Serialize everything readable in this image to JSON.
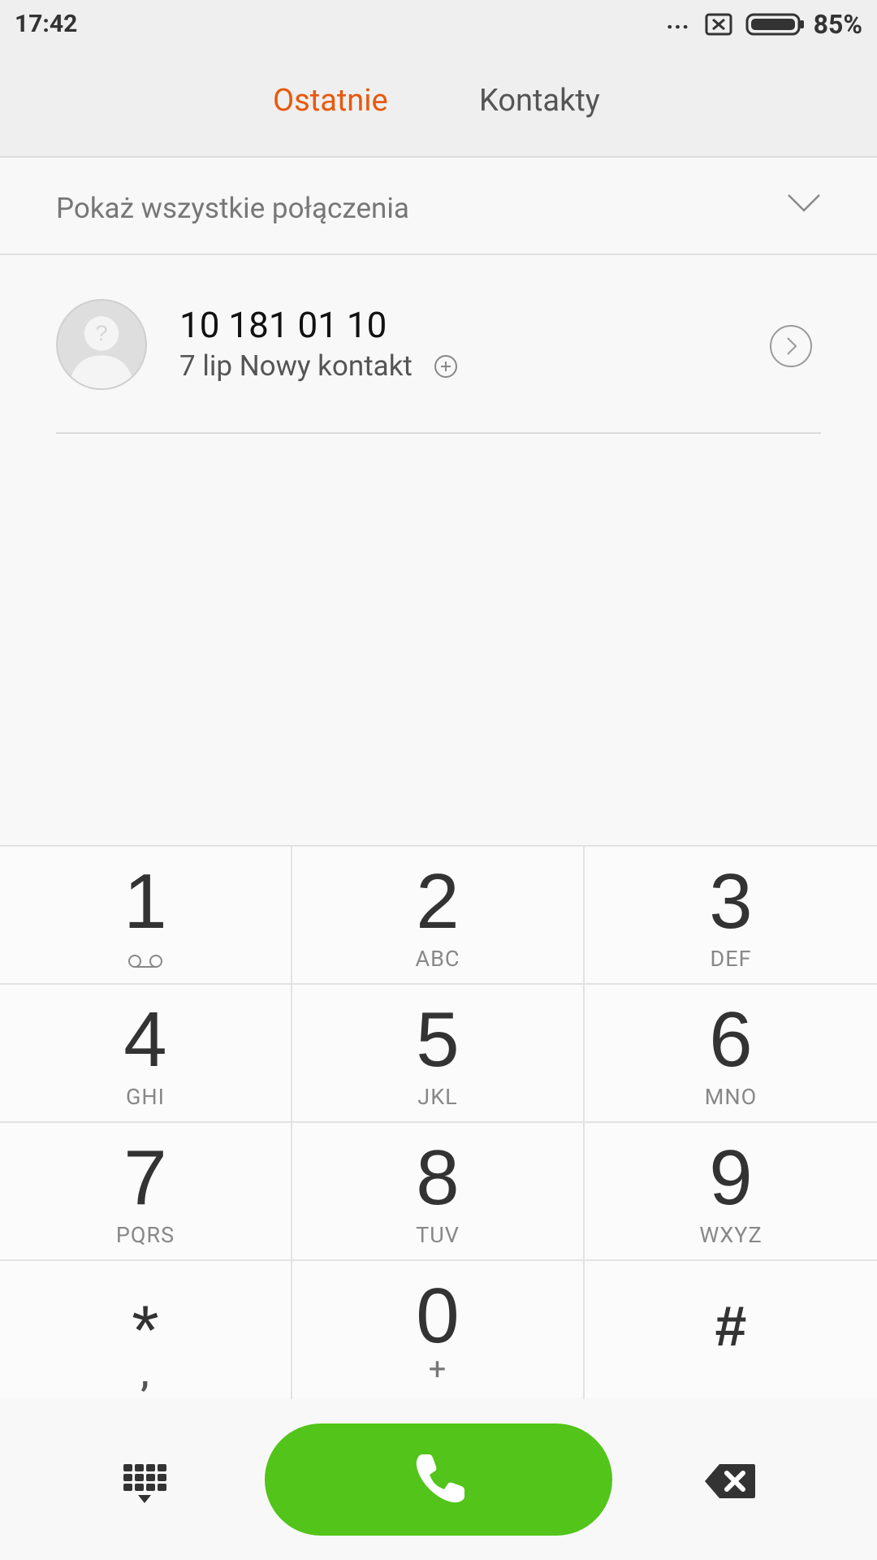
{
  "status_bar": {
    "time": "17:42",
    "dots": "...",
    "battery": "85%",
    "icons": [
      "sim-disabled-icon",
      "battery-icon"
    ]
  },
  "tabs": [
    {
      "label": "Ostatnie",
      "active": true
    },
    {
      "label": "Kontakty",
      "active": false
    }
  ],
  "filter": {
    "label": "Pokaż wszystkie połączenia",
    "icon": "chevron-down-icon"
  },
  "call_log": [
    {
      "number": "10 181 01 10",
      "subtitle": "7 lip Nowy kontakt",
      "icons": [
        "avatar-placeholder-icon",
        "add-contact-icon",
        "details-icon"
      ]
    }
  ],
  "keypad": {
    "keys": [
      {
        "digit": "1",
        "letters": ""
      },
      {
        "digit": "2",
        "letters": "ABC"
      },
      {
        "digit": "3",
        "letters": "DEF"
      },
      {
        "digit": "4",
        "letters": "GHI"
      },
      {
        "digit": "5",
        "letters": "JKL"
      },
      {
        "digit": "6",
        "letters": "MNO"
      },
      {
        "digit": "7",
        "letters": "PQRS"
      },
      {
        "digit": "8",
        "letters": "TUV"
      },
      {
        "digit": "9",
        "letters": "WXYZ"
      },
      {
        "digit": "*",
        "letters": ","
      },
      {
        "digit": "0",
        "letters": "+"
      },
      {
        "digit": "#",
        "letters": ""
      }
    ]
  },
  "bottom_bar": {
    "icons": [
      "dialpad-icon",
      "phone-icon",
      "backspace-icon"
    ]
  },
  "colors": {
    "accent": "#e8590c",
    "call_green": "#52c41a",
    "background": "#f8f8f8",
    "header_bg": "#efefef"
  }
}
